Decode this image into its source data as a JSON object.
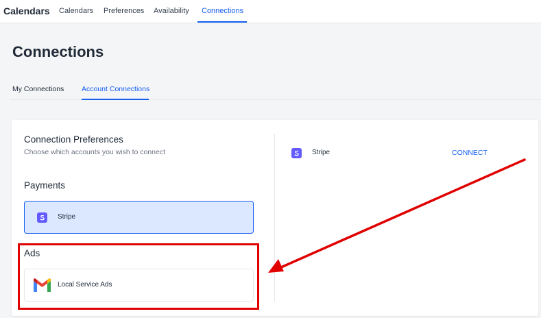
{
  "nav": {
    "brand": "Calendars",
    "tabs": [
      {
        "label": "Calendars"
      },
      {
        "label": "Preferences"
      },
      {
        "label": "Availability"
      },
      {
        "label": "Connections",
        "active": true
      }
    ]
  },
  "page": {
    "title": "Connections",
    "subtabs": [
      {
        "label": "My Connections"
      },
      {
        "label": "Account Connections",
        "active": true
      }
    ]
  },
  "preferences": {
    "heading": "Connection Preferences",
    "subtitle": "Choose which accounts you wish to connect"
  },
  "payments": {
    "heading": "Payments",
    "option_label": "Stripe",
    "option_icon": "stripe-icon",
    "selected": true
  },
  "ads": {
    "heading": "Ads",
    "option_label": "Local Service Ads",
    "option_icon": "gmail-icon"
  },
  "detail": {
    "provider_label": "Stripe",
    "provider_icon": "stripe-icon",
    "action_label": "CONNECT"
  },
  "colors": {
    "accent": "#155eef",
    "selected_bg": "#dbe8ff",
    "stripe": "#635bff",
    "annotation": "#e00000"
  }
}
